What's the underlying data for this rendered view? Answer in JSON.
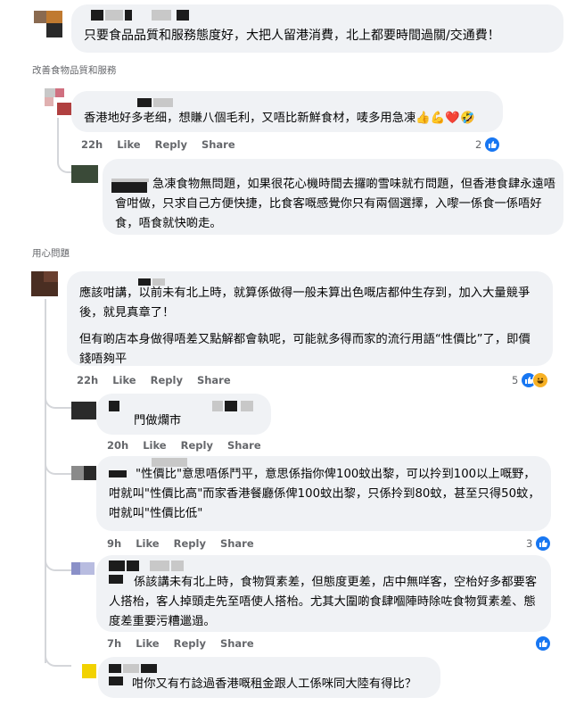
{
  "sections": {
    "improve_label": "改善食物品質和服務",
    "attitude_label": "用心問題"
  },
  "comments": {
    "c0": {
      "text": "只要食品品質和服務態度好，大把人留港消費，北上都要時間過關/交通費！"
    },
    "c1": {
      "text": "香港地好多老细，想賺八個毛利，又唔比新鮮食材，唛多用急凍👍💪❤️🤣",
      "time": "22h",
      "like": "Like",
      "reply": "Reply",
      "share": "Share",
      "reaction_count": "2"
    },
    "c2": {
      "text": "急凍食物無問題，如果很花心機時間去攞啲雪味就冇問題，但香港食肆永遠唔會咁做，只求自己方便快捷，比食客嘅感覺你只有兩個選擇，入嚟一係食一係唔好食，唔食就快啲走。"
    },
    "c3": {
      "para1": "應該咁講，以前未有北上時，就算係做得一般未算出色嘅店都仲生存到，加入大量競爭後，就見真章了！",
      "para2": "但有啲店本身做得唔差又點解都會執呢，可能就多得而家的流行用語“性價比”了，即價錢唔夠平",
      "time": "22h",
      "like": "Like",
      "reply": "Reply",
      "share": "Share",
      "reaction_count": "5"
    },
    "c4": {
      "text": "門做爛市",
      "time": "20h",
      "like": "Like",
      "reply": "Reply",
      "share": "Share"
    },
    "c5": {
      "text": "\"性價比\"意思唔係鬥平，意思係指你俾100蚊出黎，可以拎到100以上嘅野，咁就叫\"性價比高\"而家香港餐廳係俾100蚊出黎，只係拎到80蚊，甚至只得50蚊，咁就叫\"性價比低\"",
      "time": "9h",
      "like": "Like",
      "reply": "Reply",
      "share": "Share",
      "reaction_count": "3"
    },
    "c6": {
      "text": "係該講未有北上時，食物質素差，但態度更差，店中無咩客，空枱好多都要客人搭枱，客人掉頭走先至唔使人搭枱。尤其大圍啲食肆嗰陣時除咗食物質素差、態度差重要污糟邋遢。",
      "time": "7h",
      "like": "Like",
      "reply": "Reply",
      "share": "Share"
    },
    "c7": {
      "text": "咁你又有冇諗過香港嘅租金跟人工係咪同大陸有得比？"
    }
  },
  "colors": {
    "bubble": "#f0f2f5",
    "meta": "#65676b",
    "like_blue": "#1877f2"
  },
  "icons": {
    "like": "like-icon",
    "haha": "haha-icon",
    "love": "love-icon"
  }
}
